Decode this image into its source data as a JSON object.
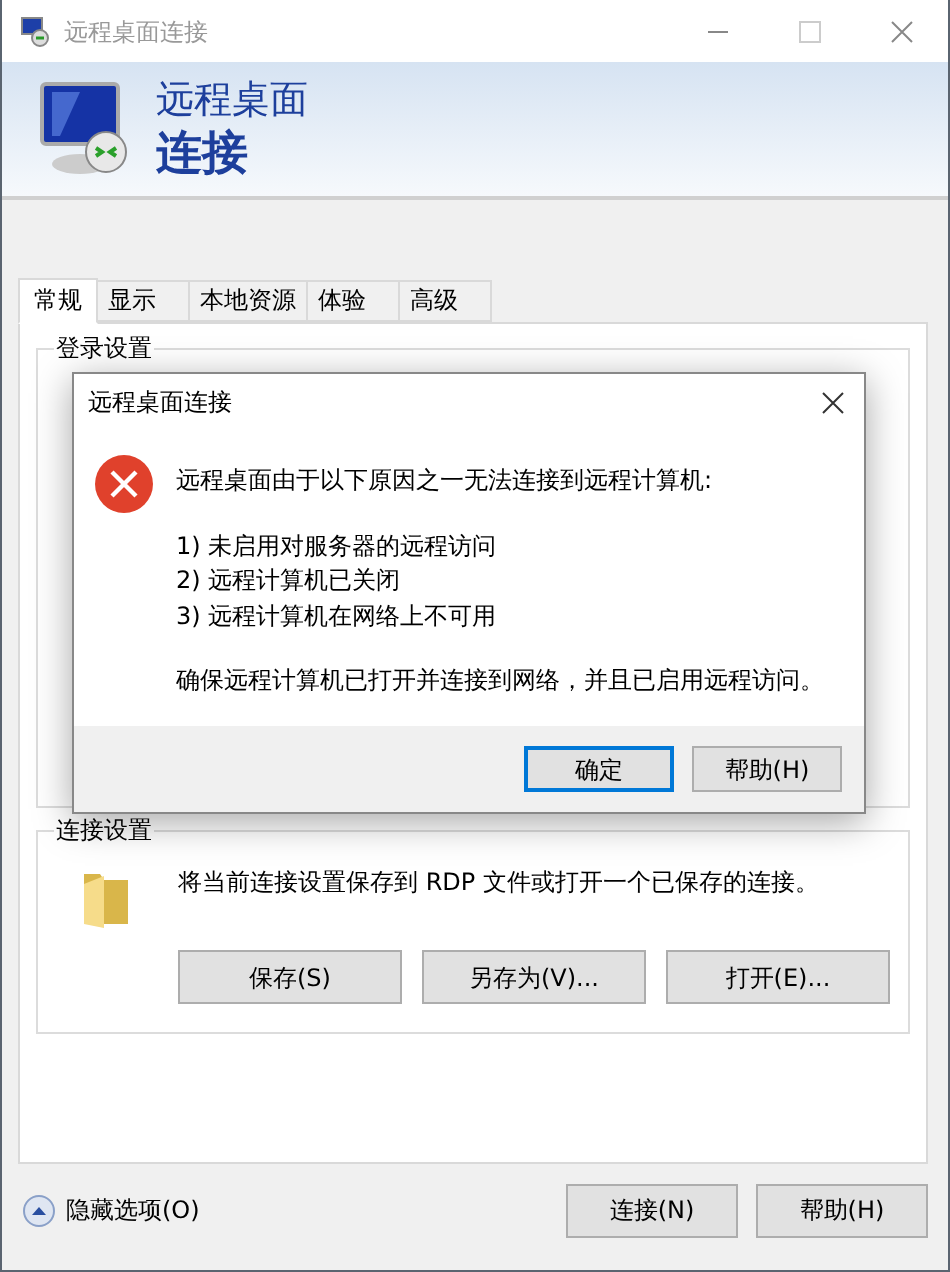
{
  "window": {
    "title": "远程桌面连接"
  },
  "header": {
    "line_1": "远程桌面",
    "line_2": "连接"
  },
  "tabs": [
    {
      "label": "常规",
      "selected": true
    },
    {
      "label": "显示",
      "selected": false
    },
    {
      "label": "本地资源",
      "selected": false
    },
    {
      "label": "体验",
      "selected": false
    },
    {
      "label": "高级",
      "selected": false
    }
  ],
  "login_group": {
    "title": "登录设置"
  },
  "connection_group": {
    "title": "连接设置",
    "description": "将当前连接设置保存到 RDP 文件或打开一个已保存的连接。",
    "buttons": [
      "保存(S)",
      "另存为(V)...",
      "打开(E)..."
    ]
  },
  "footer": {
    "toggle": "隐藏选项(O)",
    "buttons": [
      "连接(N)",
      "帮助(H)"
    ]
  },
  "dialog": {
    "title": "远程桌面连接",
    "message": "远程桌面由于以下原因之一无法连接到远程计算机:",
    "reasons": [
      "1) 未启用对服务器的远程访问",
      "2) 远程计算机已关闭",
      "3) 远程计算机在网络上不可用"
    ],
    "advice": "确保远程计算机已打开并连接到网络，并且已启用远程访问。",
    "buttons": [
      {
        "label": "确定",
        "selected": true
      },
      {
        "label": "帮助(H)",
        "selected": false
      }
    ]
  }
}
